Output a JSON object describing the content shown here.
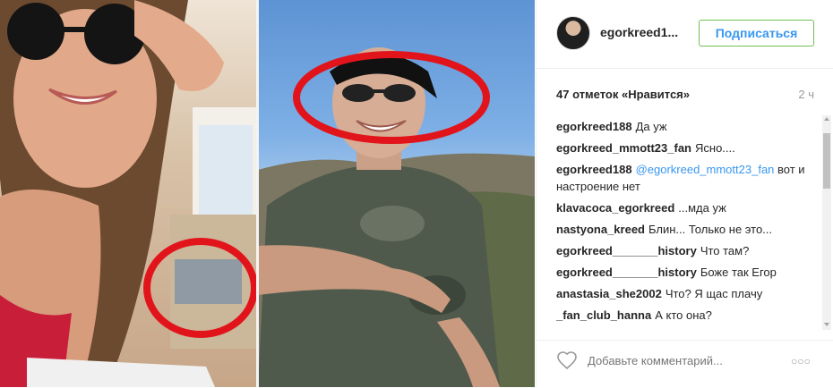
{
  "post": {
    "username": "egorkreed1...",
    "follow_label": "Подписаться",
    "likes": "47 отметок «Нравится»",
    "time": "2 ч",
    "comment_placeholder": "Добавьте комментарий...",
    "more_label": "○○○"
  },
  "comments": [
    {
      "author": "egorkreed188",
      "text": "Да уж"
    },
    {
      "author": "egorkreed_mmott23_fan",
      "text": "Ясно...."
    },
    {
      "author": "egorkreed188",
      "mention": "@egorkreed_mmott23_fan",
      "text": " вот и настроение нет"
    },
    {
      "author": "klavacoca_egorkreed",
      "text": "...мда уж"
    },
    {
      "author": "nastyona_kreed",
      "text": "Блин... Только не это..."
    },
    {
      "author": "egorkreed_______history",
      "text": "Что там?"
    },
    {
      "author": "egorkreed_______history",
      "text": "Боже так Егор"
    },
    {
      "author": "anastasia_she2002",
      "text": "Что? Я щас плачу"
    },
    {
      "author": "_fan_club_hanna",
      "text": "А кто она?"
    }
  ],
  "colors": {
    "follow_text": "#3897f0",
    "follow_border": "#70c050",
    "annotation_red": "#e2141b"
  }
}
